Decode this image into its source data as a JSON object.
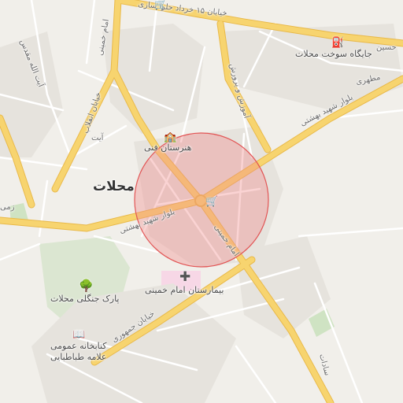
{
  "map": {
    "city_label": "محلات",
    "colors": {
      "background": "#f1efea",
      "major_road": "#f6cf6a",
      "minor_road": "#ffffff",
      "park": "#d8e6cc",
      "hospital": "#f6d6e6",
      "radius_fill": "#f28b8b",
      "radius_stroke": "#e25555"
    },
    "road_labels": {
      "khordad": "خیابان ۱۵ خرداد حلوا سازی",
      "imam_khomeini_north": "امام خمینی",
      "enghelab": "خیابان انقلاب",
      "ayatollah": "آیت الله مقدس",
      "ayat": "آیت",
      "beheshti_ne": "بلوار شهید بهشتی",
      "beheshti_w": "بلوار شهید بهشتی",
      "imam_khomeini_south": "امام خمینی",
      "jomhouri": "خیابان جمهوری",
      "mahtari": "مطهری",
      "amouzesh": "آموزش و پرورش",
      "hosseini": "حسین",
      "sadat": "سادات",
      "zamin": "زمی"
    },
    "poi_labels": {
      "fuel_station": "جایگاه سوخت محلات",
      "technical_school": "هنرستان فنی",
      "hospital": "بیمارستان امام خمینی",
      "park": "پارک جنگلی محلات",
      "library_line1": "کتابخانه عمومی",
      "library_line2": "علامه طباطبایی"
    },
    "icons": [
      "fuel-icon",
      "school-icon",
      "shop-icon",
      "hospital-icon",
      "tree-icon",
      "library-icon",
      "shop-icon-north"
    ]
  }
}
